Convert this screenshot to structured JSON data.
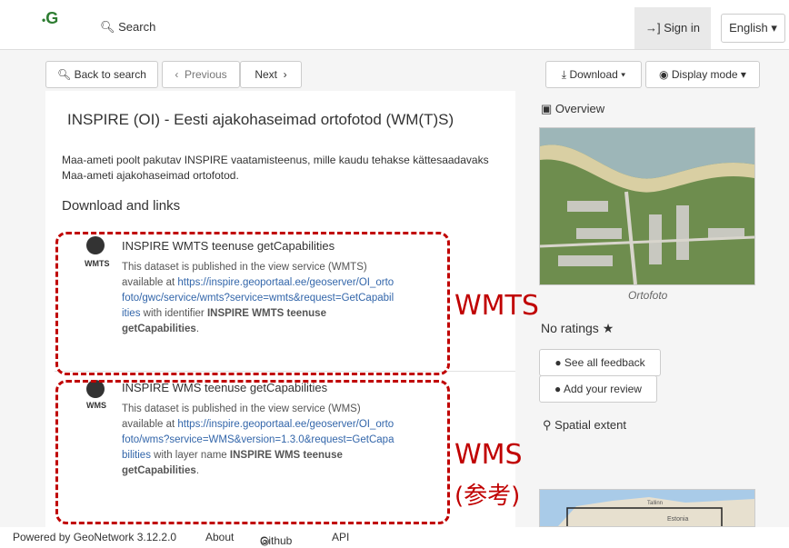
{
  "header": {
    "logo_text": "G",
    "search_label": "Search",
    "signin_label": "Sign in",
    "language": "English"
  },
  "toolbar": {
    "back_label": "Back to search",
    "previous_label": "Previous",
    "next_label": "Next",
    "download_label": "Download",
    "display_mode_label": "Display mode"
  },
  "record": {
    "title": "INSPIRE (OI) - Eesti ajakohaseimad ortofotod (WM(T)S)",
    "description": "Maa-ameti poolt pakutav INSPIRE vaatamisteenus, mille kaudu tehakse kättesaadavaks Maa-ameti ajakohaseimad ortofotod.",
    "links_heading": "Download and links"
  },
  "links": [
    {
      "tag": "WMTS",
      "title": "INSPIRE WMTS teenuse getCapabilities",
      "body_prefix": "This dataset is published in the view service (WMTS) available at",
      "url": "https://inspire.geoportaal.ee/geoserver/OI_ortofoto/gwc/service/wmts?service=wmts&request=GetCapabilities",
      "body_mid": " with identifier ",
      "strong": "INSPIRE WMTS teenuse getCapabilities",
      "body_suffix": "."
    },
    {
      "tag": "WMS",
      "title": "INSPIRE WMS teenuse getCapabilities",
      "body_prefix": "This dataset is published in the view service (WMS) available at",
      "url": "https://inspire.geoportaal.ee/geoserver/OI_ortofoto/wms?service=WMS&version=1.3.0&request=GetCapabilities",
      "body_mid": " with layer name ",
      "strong": "INSPIRE WMS teenuse getCapabilities",
      "body_suffix": "."
    }
  ],
  "annotations": {
    "wmts": "WMTS",
    "wms": "WMS",
    "wms_note": "(参考)"
  },
  "sidebar": {
    "overview_label": "Overview",
    "thumb_caption": "Ortofoto",
    "ratings": "No ratings",
    "see_feedback": "See all feedback",
    "add_review": "Add your review",
    "spatial_extent": "Spatial extent",
    "map_labels": [
      "Estonia",
      "Tallinn"
    ]
  },
  "footer": {
    "powered": "Powered by GeoNetwork 3.12.2.0",
    "about": "About",
    "github": "Github",
    "api": "API"
  },
  "colors": {
    "annotation_red": "#c00000",
    "link_blue": "#3366aa"
  }
}
